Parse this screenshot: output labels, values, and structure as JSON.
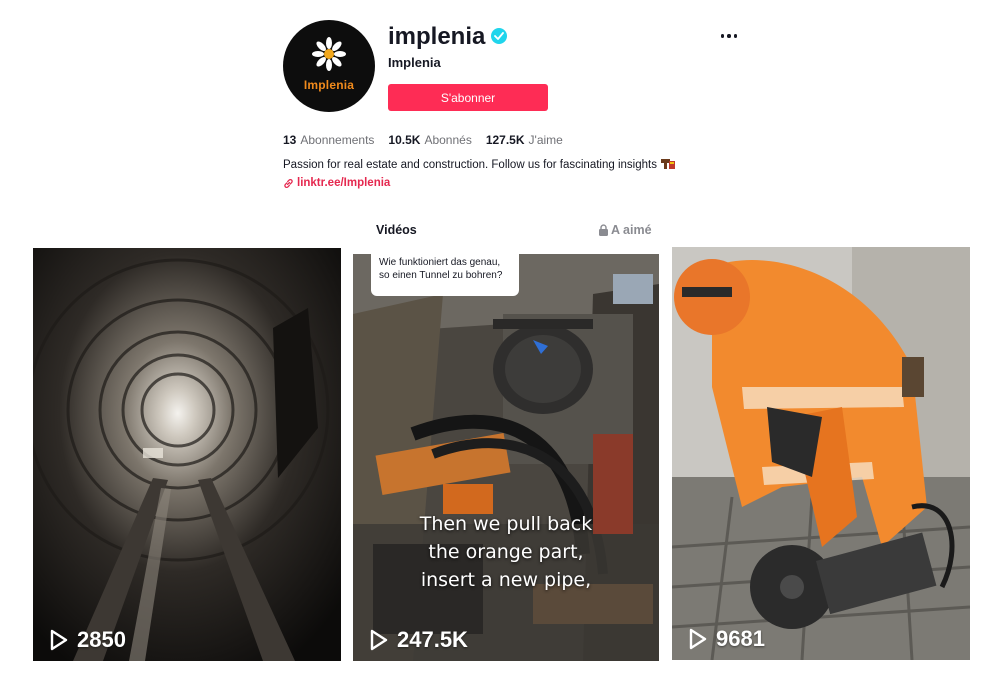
{
  "profile": {
    "avatar_text": "Implenia",
    "username": "implenia",
    "nickname": "Implenia",
    "follow_label": "S'abonner",
    "stats": [
      {
        "num": "13",
        "label": "Abonnements"
      },
      {
        "num": "10.5K",
        "label": "Abonnés"
      },
      {
        "num": "127.5K",
        "label": "J'aime"
      }
    ],
    "bio": "Passion for real estate and construction. Follow us for fascinating insights",
    "link": "linktr.ee/Implenia"
  },
  "tabs": {
    "videos": "Vidéos",
    "liked": "A aimé"
  },
  "videos": [
    {
      "views": "2850"
    },
    {
      "views": "247.5K",
      "reply_caption": "Wie funktioniert das genau, so einen Tunnel zu bohren?",
      "overlay_lines": [
        "Then we pull back",
        "the orange part,",
        "insert a new pipe,"
      ]
    },
    {
      "views": "9681"
    }
  ],
  "colors": {
    "accent": "#fe2c55",
    "link": "#e5284f",
    "verified": "#20d5ec",
    "brand_orange": "#f08a1c"
  }
}
